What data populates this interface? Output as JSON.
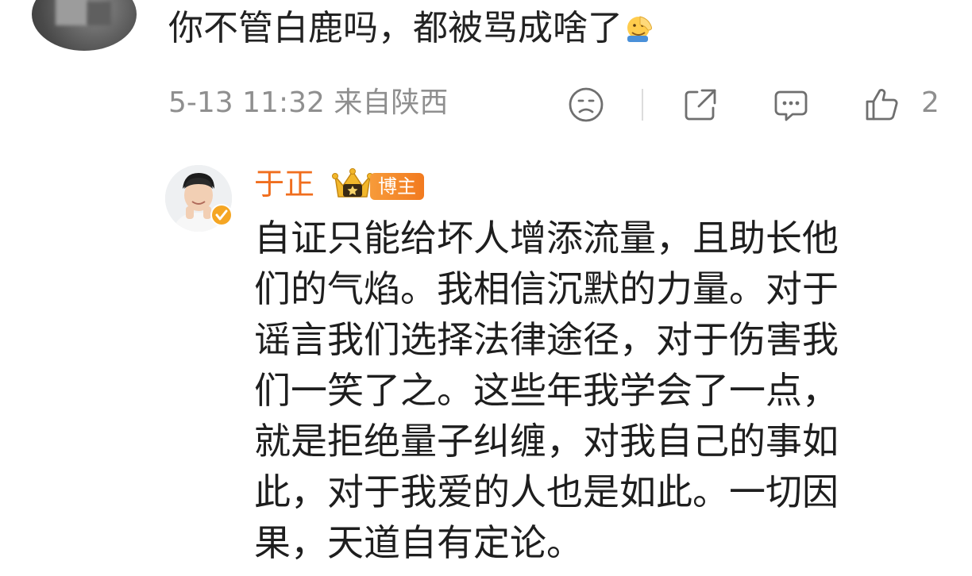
{
  "comment": {
    "text": "你不管白鹿吗，都被骂成啥了",
    "emoji": "facepalm-emoji",
    "time": "5-13 11:32",
    "location": "来自陕西",
    "like_count": "2"
  },
  "reply": {
    "author": "于正",
    "badge": "博主",
    "lines": [
      "自证只能给坏人增添流量，且助长他",
      "们的气焰。我相信沉默的力量。对于",
      "谣言我们选择法律途径，对于伤害我",
      "们一笑了之。这些年我学会了一点，",
      "就是拒绝量子纠缠，对我自己的事如",
      "此，对于我爱的人也是如此。一切因",
      "果，天道自有定论。"
    ]
  },
  "icons": {
    "sad": "sad-face-icon",
    "share": "share-icon",
    "comment": "comment-icon",
    "like": "thumbs-up-icon",
    "crown": "crown-icon",
    "verified": "verified-badge-icon"
  },
  "colors": {
    "author": "#f06e1e",
    "meta": "#8f8f8f",
    "badge": "#f27a1f",
    "verified": "#f5a623"
  }
}
